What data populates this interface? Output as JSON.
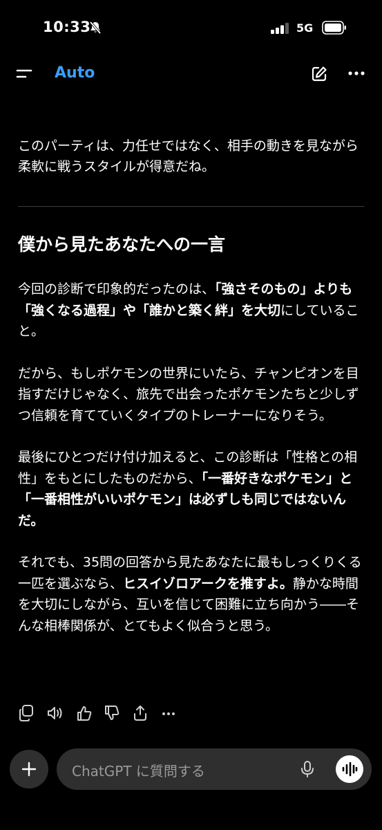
{
  "status_bar": {
    "time": "10:33",
    "network": "5G",
    "icons": [
      "bell-slash-icon",
      "signal-bars-icon",
      "battery-icon"
    ]
  },
  "nav": {
    "model_label": "Auto",
    "icons": [
      "menu-icon",
      "new-chat-icon",
      "more-icon"
    ]
  },
  "message": {
    "intro": "このパーティは、力任せではなく、相手の動きを見ながら柔軟に戦うスタイルが得意だね。",
    "heading": "僕から見たあなたへの一言",
    "p1_a": "今回の診断で印象的だったのは、",
    "p1_b": "「強さそのもの」よりも「強くなる過程」や「誰かと築く絆」を大切",
    "p1_c": "にしていること。",
    "p2": "だから、もしポケモンの世界にいたら、チャンピオンを目指すだけじゃなく、旅先で出会ったポケモンたちと少しずつ信頼を育てていくタイプのトレーナーになりそう。",
    "p3_a": "最後にひとつだけ付け加えると、この診断は「性格との相性」をもとにしたものだから、",
    "p3_b": "「一番好きなポケモン」と「一番相性がいいポケモン」は必ずしも同じではないんだ。",
    "p4_a": "それでも、35問の回答から見たあなたに最もしっくりくる一匹を選ぶなら、",
    "p4_b": "ヒスイゾロアークを推すよ。",
    "p4_c": "静かな時間を大切にしながら、互いを信じて困難に立ち向かう――そんな相棒関係が、とてもよく似合うと思う。"
  },
  "actions": [
    "copy-icon",
    "read-aloud-icon",
    "thumbs-up-icon",
    "thumbs-down-icon",
    "share-icon",
    "more-horizontal-icon"
  ],
  "composer": {
    "placeholder": "ChatGPT に質問する",
    "icons": [
      "plus-icon",
      "mic-icon",
      "voice-mode-icon"
    ]
  },
  "colors": {
    "background": "#000000",
    "accent": "#3b9eff",
    "composer_bg": "#2f2f2f",
    "placeholder": "#9a9a9a"
  }
}
